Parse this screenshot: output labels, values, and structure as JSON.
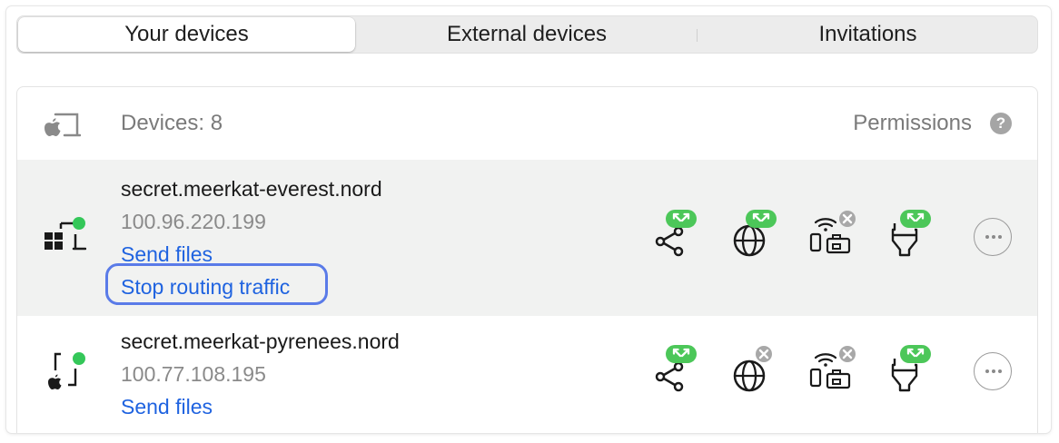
{
  "tabs": [
    {
      "label": "Your devices",
      "active": true
    },
    {
      "label": "External devices",
      "active": false
    },
    {
      "label": "Invitations",
      "active": false
    }
  ],
  "header": {
    "count_label": "Devices: 8",
    "permissions_label": "Permissions",
    "help_glyph": "?"
  },
  "devices": [
    {
      "name": "secret.meerkat-everest.nord",
      "ip": "100.96.220.199",
      "actions": [
        "Send files",
        "Stop routing traffic"
      ],
      "platform_icon": "windows-laptop-icon",
      "online": true,
      "permissions": {
        "file_sharing": "allowed",
        "routing": "allowed",
        "local_network": "denied",
        "remote_access": "allowed"
      }
    },
    {
      "name": "secret.meerkat-pyrenees.nord",
      "ip": "100.77.108.195",
      "actions": [
        "Send files"
      ],
      "platform_icon": "apple-phone-icon",
      "online": true,
      "permissions": {
        "file_sharing": "allowed",
        "routing": "denied",
        "local_network": "denied",
        "remote_access": "allowed"
      }
    }
  ],
  "colors": {
    "allowed": "#4cc759",
    "denied": "#a8a8a8",
    "link": "#1f63e0",
    "online": "#34c759"
  }
}
